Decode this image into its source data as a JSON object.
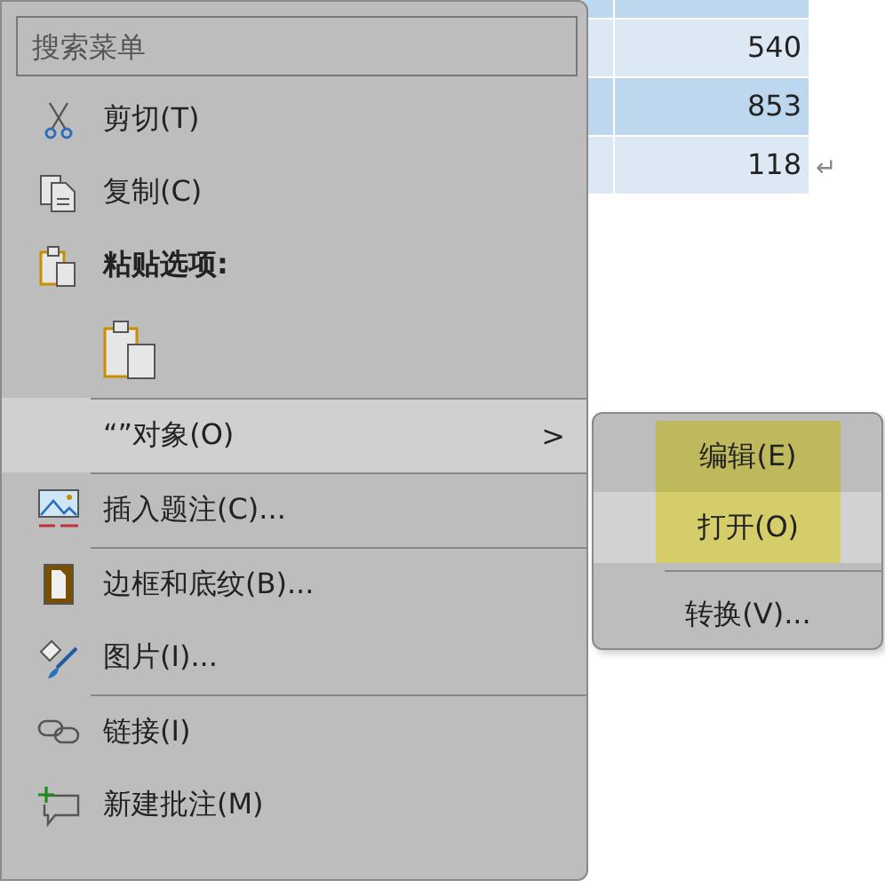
{
  "table": {
    "rows": [
      {
        "value": "540"
      },
      {
        "value": "853"
      },
      {
        "value": "118"
      }
    ],
    "end_mark": "↵"
  },
  "menu": {
    "search": {
      "placeholder": "搜索菜单"
    },
    "items": [
      {
        "kind": "item",
        "label": "剪切(T)",
        "selected": false,
        "separator_above": false
      },
      {
        "kind": "item",
        "label": "复制(C)",
        "selected": false,
        "separator_above": false
      },
      {
        "kind": "heading",
        "label": "粘贴选项:",
        "separator_above": false
      },
      {
        "kind": "paste-option",
        "selected": false,
        "separator_above": false
      },
      {
        "kind": "submenu",
        "label": "“”对象(O)",
        "arrow": ">",
        "selected": true,
        "separator_above": true
      },
      {
        "kind": "item",
        "label": "插入题注(C)...",
        "selected": false,
        "separator_above": true
      },
      {
        "kind": "item",
        "label": "边框和底纹(B)...",
        "selected": false,
        "separator_above": true
      },
      {
        "kind": "item",
        "label": "图片(I)...",
        "selected": false,
        "separator_above": false
      },
      {
        "kind": "item",
        "label": "链接(I)",
        "selected": false,
        "separator_above": true
      },
      {
        "kind": "item",
        "label": "新建批注(M)",
        "selected": false,
        "separator_above": false
      }
    ]
  },
  "submenu": {
    "items": [
      {
        "label": "编辑(E)",
        "highlighted": true,
        "selected": false,
        "separator_above": false
      },
      {
        "label": "打开(O)",
        "highlighted": true,
        "selected": true,
        "separator_above": false
      },
      {
        "label": "转换(V)...",
        "highlighted": false,
        "selected": false,
        "separator_above": true
      }
    ]
  }
}
